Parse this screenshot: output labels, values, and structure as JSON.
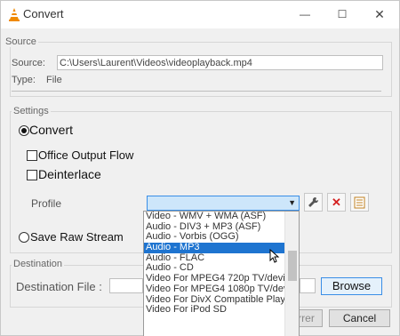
{
  "window": {
    "title": "Convert",
    "minimize_glyph": "—",
    "maximize_glyph": "☐",
    "close_glyph": "✕"
  },
  "source": {
    "group_label": "Source",
    "source_label": "Source:",
    "source_value": "C:\\Users\\Laurent\\Videos\\videoplayback.mp4",
    "type_label": "Type:",
    "type_value": "File"
  },
  "settings": {
    "group_label": "Settings",
    "convert_label": "Convert",
    "convert_selected": true,
    "office_output_label": "Office Output Flow",
    "deinterlace_label": "Deinterlace",
    "profile_label": "Profile",
    "save_raw_label": "Save Raw Stream",
    "edit_icon": "wrench-icon",
    "delete_icon": "red-x-icon",
    "new_icon": "new-profile-icon"
  },
  "dropdown": {
    "items": [
      "Video - WMV + WMA (ASF)",
      "Audio - DIV3 + MP3 (ASF)",
      "Audio - Vorbis (OGG)",
      "Audio - MP3",
      "Audio - FLAC",
      "Audio - CD",
      "Video For MPEG4 720p TV/device",
      "Video For MPEG4 1080p TV/device",
      "Video For DivX Compatible Player",
      "Video For iPod SD"
    ],
    "selected_index": 3
  },
  "destination": {
    "group_label": "Destination",
    "file_label": "Destination File :",
    "browse_label": "Browse"
  },
  "buttons": {
    "start_label": "Démarrer",
    "cancel_label": "Cancel"
  },
  "colors": {
    "accent": "#1e74d0",
    "highlight": "#cde6fa",
    "delete_red": "#d42020"
  }
}
